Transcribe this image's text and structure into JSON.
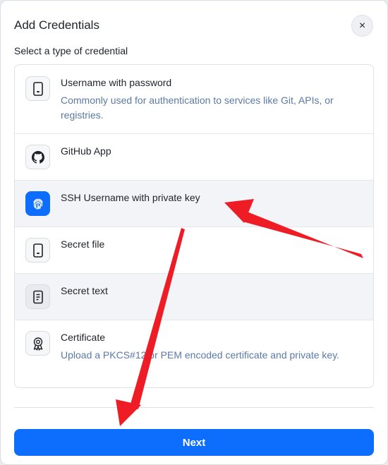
{
  "dialog": {
    "title": "Add Credentials",
    "close_label": "×",
    "subtitle": "Select a type of credential",
    "next_label": "Next"
  },
  "credential_types": [
    {
      "title": "Username with password",
      "description": "Commonly used for authentication to services like Git, APIs, or registries.",
      "icon": "phone-icon"
    },
    {
      "title": "GitHub App",
      "description": "",
      "icon": "github-icon"
    },
    {
      "title": "SSH Username with private key",
      "description": "",
      "icon": "fingerprint-icon"
    },
    {
      "title": "Secret file",
      "description": "",
      "icon": "phone-icon"
    },
    {
      "title": "Secret text",
      "description": "",
      "icon": "document-icon"
    },
    {
      "title": "Certificate",
      "description": "Upload a PKCS#12 or PEM encoded certificate and private key.",
      "icon": "award-icon"
    }
  ],
  "colors": {
    "accent": "#0d6efd",
    "description_text": "#5a7aa6",
    "annotation_arrow": "#ee1c25"
  }
}
